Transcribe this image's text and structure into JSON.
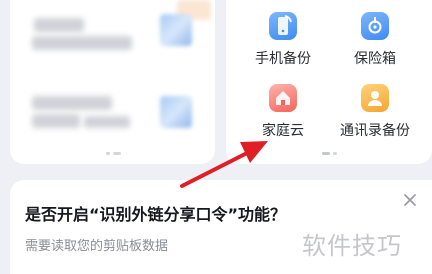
{
  "tools": [
    {
      "label": "手机备份",
      "icon": "phone-backup-icon"
    },
    {
      "label": "保险箱",
      "icon": "safe-icon"
    },
    {
      "label": "家庭云",
      "icon": "family-cloud-icon"
    },
    {
      "label": "通讯录备份",
      "icon": "contacts-backup-icon"
    }
  ],
  "prompt": {
    "title": "是否开启“识别外链分享口令”功能？",
    "subtitle": "需要读取您的剪贴板数据",
    "close_icon": "close-icon"
  },
  "watermark": "软件技巧",
  "colors": {
    "accent": "#3e8bf2",
    "arrow": "#e01e25",
    "home_icon": "#f2655a",
    "contact_icon": "#f4a52e"
  }
}
